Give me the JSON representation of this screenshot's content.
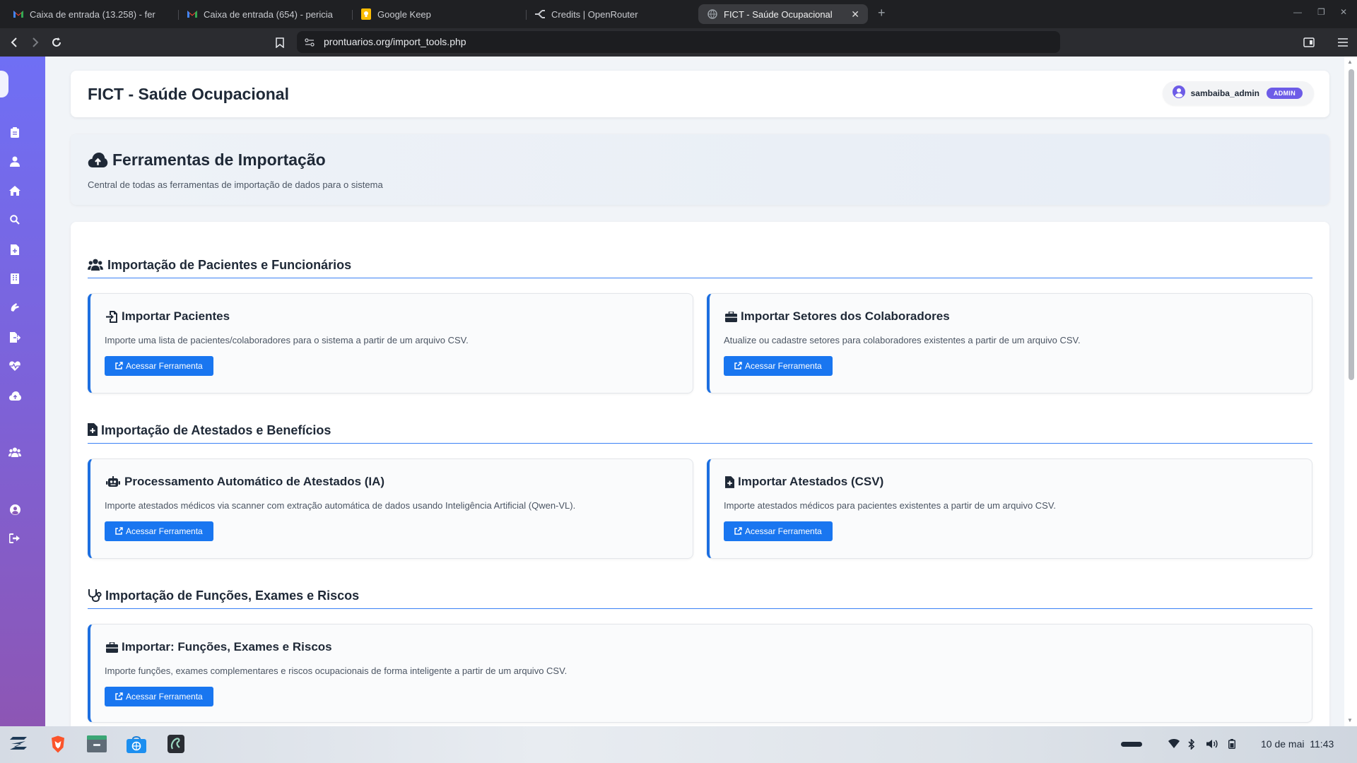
{
  "browser": {
    "tabs": [
      {
        "title": "Caixa de entrada (13.258) - fer",
        "icon": "gmail-icon"
      },
      {
        "title": "Caixa de entrada (654) - pericia",
        "icon": "gmail-icon"
      },
      {
        "title": "Google Keep",
        "icon": "keep-icon"
      },
      {
        "title": "Credits | OpenRouter",
        "icon": "openrouter-icon"
      },
      {
        "title": "FICT - Saúde Ocupacional",
        "icon": "globe-icon",
        "active": true
      }
    ],
    "url": "prontuarios.org/import_tools.php"
  },
  "header": {
    "title": "FICT - Saúde Ocupacional",
    "username": "sambaiba_admin",
    "role_badge": "ADMIN"
  },
  "hero": {
    "title": "Ferramentas de Importação",
    "subtitle": "Central de todas as ferramentas de importação de dados para o sistema"
  },
  "sections": [
    {
      "title": "Importação de Pacientes e Funcionários",
      "icon": "users-icon",
      "tools": [
        {
          "title": "Importar Pacientes",
          "icon": "file-import-icon",
          "description": "Importe uma lista de pacientes/colaboradores para o sistema a partir de um arquivo CSV.",
          "button": "Acessar Ferramenta"
        },
        {
          "title": "Importar Setores dos Colaboradores",
          "icon": "briefcase-icon",
          "description": "Atualize ou cadastre setores para colaboradores existentes a partir de um arquivo CSV.",
          "button": "Acessar Ferramenta"
        }
      ]
    },
    {
      "title": "Importação de Atestados e Benefícios",
      "icon": "file-medical-icon",
      "tools": [
        {
          "title": "Processamento Automático de Atestados (IA)",
          "icon": "robot-icon",
          "description": "Importe atestados médicos via scanner com extração automática de dados usando Inteligência Artificial (Qwen-VL).",
          "button": "Acessar Ferramenta"
        },
        {
          "title": "Importar Atestados (CSV)",
          "icon": "file-medical-icon",
          "description": "Importe atestados médicos para pacientes existentes a partir de um arquivo CSV.",
          "button": "Acessar Ferramenta"
        }
      ]
    },
    {
      "title": "Importação de Funções, Exames e Riscos",
      "icon": "stethoscope-icon",
      "tools": [
        {
          "title": "Importar: Funções, Exames e Riscos",
          "icon": "briefcase-icon",
          "description": "Importe funções, exames complementares e riscos ocupacionais de forma inteligente a partir de um arquivo CSV.",
          "button": "Acessar Ferramenta"
        }
      ]
    }
  ],
  "sidebar_icons": [
    "clipboard-icon",
    "user-doctor-icon",
    "home-icon",
    "search-icon",
    "file-add-icon",
    "building-icon",
    "hands-icon",
    "file-export-icon",
    "heartbeat-icon",
    "cloud-upload-icon",
    "users-icon",
    "user-circle-icon",
    "logout-icon"
  ],
  "taskbar": {
    "clock_date": "10 de mai",
    "clock_time": "11:43"
  },
  "colors": {
    "accent": "#1976f0",
    "sidebar_top": "#6f6ff5",
    "sidebar_bottom": "#8d56b4",
    "admin_badge": "#6d5ce7"
  }
}
